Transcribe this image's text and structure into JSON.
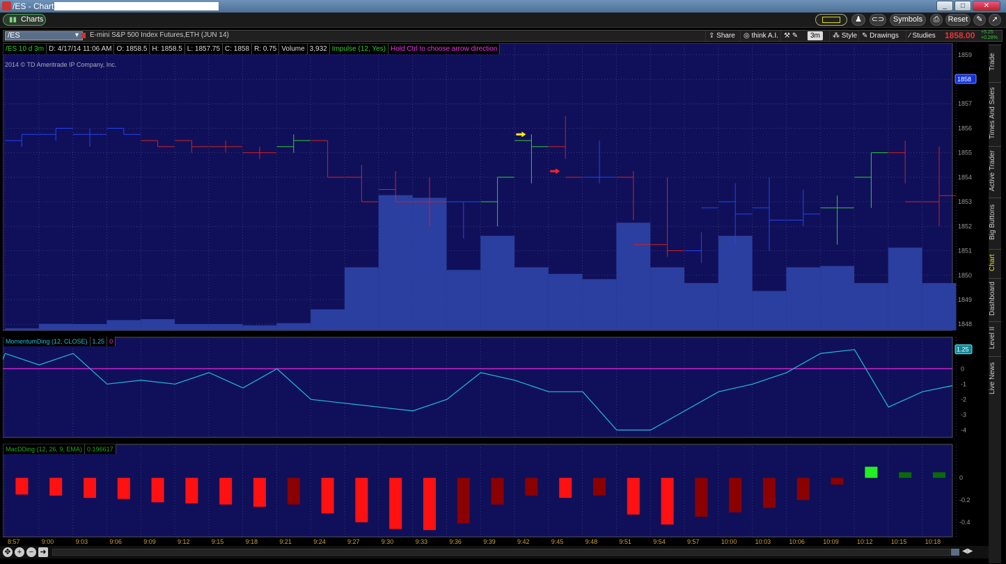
{
  "window": {
    "title": "/ES - Charts -"
  },
  "toolbar": {
    "charts_label": "Charts",
    "symbols_label": "Symbols",
    "reset_label": "Reset"
  },
  "chart_header": {
    "symbol": "/ES",
    "description": "E-mini S&P 500 Index Futures,ETH (JUN 14)",
    "buttons": {
      "share": "Share",
      "think_ai": "think A.I.",
      "timeframe": "3m",
      "style": "Style",
      "drawings": "Drawings",
      "studies": "Studies"
    },
    "last_price": "1858.00",
    "change": "+5.25",
    "change_pct": "+0.28%"
  },
  "infobar": {
    "period": "/ES 10 d 3m",
    "date": "D: 4/17/14 11:06 AM",
    "open": "O: 1858.5",
    "high": "H: 1858.5",
    "low": "L: 1857.75",
    "close": "C: 1858",
    "range": "R: 0.75",
    "volume_label": "Volume",
    "volume": "3,932",
    "impulse": "Impulse (12, Yes)",
    "hint": "Hold Ctrl to choose arrow direction"
  },
  "copyright": "2014 © TD Ameritrade IP Company, Inc.",
  "momentum": {
    "label": "MomentumDing (12, CLOSE)",
    "value": "1.25",
    "zero": "0"
  },
  "macd": {
    "label": "MacDDing (12, 26, 9, EMA)",
    "value": "0.196617"
  },
  "right_nav": [
    "Trade",
    "Times And Sales",
    "Active Trader",
    "Big Buttons",
    "Chart",
    "Dashboard",
    "Level II",
    "Live News"
  ],
  "colors": {
    "background": "#10105a",
    "up": "#33cc33",
    "down": "#d42020",
    "neutral": "#2244ee",
    "volume": "#2a3fa0",
    "momentum": "#22bbdd",
    "zeroline": "#cc22cc"
  },
  "chart_data": [
    {
      "type": "ohlc",
      "title": "/ES 10 d 3m",
      "x": [
        "8:57",
        "9:00",
        "9:03",
        "9:06",
        "9:09",
        "9:12",
        "9:15",
        "9:18",
        "9:21",
        "9:24",
        "9:27",
        "9:30",
        "9:33",
        "9:36",
        "9:39",
        "9:42",
        "9:45",
        "9:48",
        "9:51",
        "9:54",
        "9:57",
        "10:00",
        "10:03",
        "10:06",
        "10:09",
        "10:12",
        "10:15",
        "10:18"
      ],
      "open": [
        1855.5,
        1855.75,
        1855.75,
        1856.0,
        1855.5,
        1855.5,
        1855.25,
        1855.0,
        1855.25,
        1855.5,
        1854.0,
        1853.5,
        1853.0,
        1853.0,
        1853.0,
        1855.5,
        1855.25,
        1854.0,
        1854.0,
        1851.25,
        1851.0,
        1853.0,
        1852.75,
        1852.25,
        1852.75,
        1854.0,
        1855.0,
        1853.0
      ],
      "high": [
        1855.75,
        1856.0,
        1856.0,
        1856.0,
        1855.5,
        1855.5,
        1855.5,
        1855.25,
        1855.75,
        1855.5,
        1854.5,
        1854.25,
        1854.0,
        1853.0,
        1854.0,
        1855.75,
        1856.5,
        1855.5,
        1854.25,
        1854.0,
        1851.75,
        1853.75,
        1854.0,
        1853.5,
        1853.25,
        1855.0,
        1855.5,
        1855.25
      ],
      "high2": [
        1855.75,
        1856.0,
        1856.0,
        1856.0,
        1855.5,
        1855.5,
        1855.5,
        1855.25,
        1855.75,
        1855.5,
        1854.5,
        1854.25,
        1854.0,
        1853.0,
        1854.0,
        1855.75,
        1856.5,
        1855.25,
        1854.25,
        1854.0,
        1851.75,
        1853.75,
        1854.0,
        1853.5,
        1853.25,
        1855.0,
        1855.5,
        1855.25
      ],
      "low": [
        1855.25,
        1855.5,
        1855.25,
        1855.75,
        1855.25,
        1855.0,
        1855.0,
        1854.75,
        1855.0,
        1854.0,
        1853.0,
        1853.0,
        1852.0,
        1851.5,
        1852.0,
        1853.75,
        1854.75,
        1853.75,
        1852.25,
        1850.75,
        1850.5,
        1851.25,
        1851.0,
        1852.0,
        1851.25,
        1852.75,
        1853.75,
        1852.0
      ],
      "close": [
        1855.75,
        1856.0,
        1855.75,
        1855.75,
        1855.25,
        1855.25,
        1855.25,
        1855.0,
        1855.5,
        1854.0,
        1853.0,
        1853.0,
        1853.0,
        1853.0,
        1854.0,
        1855.25,
        1854.0,
        1854.0,
        1851.25,
        1851.0,
        1852.75,
        1852.5,
        1852.25,
        1852.5,
        1852.75,
        1855.0,
        1853.0,
        1853.25
      ],
      "bar_color": [
        "neutral",
        "neutral",
        "neutral",
        "neutral",
        "down",
        "down",
        "down",
        "down",
        "up",
        "down",
        "down",
        "down",
        "down",
        "neutral",
        "up",
        "up",
        "down",
        "neutral",
        "down",
        "down",
        "neutral",
        "neutral",
        "neutral",
        "neutral",
        "up",
        "up",
        "down",
        "down"
      ],
      "volume": [
        150,
        500,
        480,
        780,
        850,
        480,
        480,
        380,
        550,
        1600,
        4800,
        10300,
        10100,
        4600,
        7200,
        4800,
        4300,
        3900,
        8200,
        4800,
        3600,
        7200,
        3000,
        4800,
        4900,
        3600,
        6300,
        3600
      ],
      "ylim": [
        1847.75,
        1859.25
      ],
      "yticks": [
        1848,
        1849,
        1850,
        1851,
        1852,
        1853,
        1854,
        1855,
        1856,
        1857,
        1858,
        1859
      ],
      "price_label": "1858",
      "arrows": [
        {
          "x": "9:42",
          "y": 1855.75,
          "color": "yellow"
        },
        {
          "x": "9:45",
          "y": 1854.25,
          "color": "red"
        }
      ]
    },
    {
      "type": "line",
      "title": "MomentumDing (12, CLOSE)",
      "x": [
        "8:57",
        "9:00",
        "9:03",
        "9:06",
        "9:09",
        "9:12",
        "9:15",
        "9:18",
        "9:21",
        "9:24",
        "9:27",
        "9:30",
        "9:33",
        "9:36",
        "9:39",
        "9:42",
        "9:45",
        "9:48",
        "9:51",
        "9:54",
        "9:57",
        "10:00",
        "10:03",
        "10:06",
        "10:09",
        "10:12",
        "10:15",
        "10:18"
      ],
      "values": [
        1.0,
        0.25,
        1.0,
        -1.0,
        -0.75,
        -1.0,
        -0.25,
        -1.25,
        0.0,
        -2.0,
        -2.25,
        -2.5,
        -2.75,
        -2.0,
        -0.25,
        -0.75,
        -1.5,
        -1.5,
        -4.0,
        -4.0,
        -2.75,
        -1.5,
        -1.0,
        -0.25,
        1.0,
        1.25,
        -2.5,
        -1.5
      ],
      "ylim": [
        -4.3,
        1.6
      ],
      "yticks": [
        -4,
        -3,
        -2,
        -1,
        0
      ],
      "value_label": "1.25"
    },
    {
      "type": "bar",
      "title": "MacDDing (12, 26, 9, EMA)",
      "x": [
        "8:57",
        "9:00",
        "9:03",
        "9:06",
        "9:09",
        "9:12",
        "9:15",
        "9:18",
        "9:21",
        "9:24",
        "9:27",
        "9:30",
        "9:33",
        "9:36",
        "9:39",
        "9:42",
        "9:45",
        "9:48",
        "9:51",
        "9:54",
        "9:57",
        "10:00",
        "10:03",
        "10:06",
        "10:09",
        "10:12",
        "10:15",
        "10:18"
      ],
      "values": [
        -0.15,
        -0.16,
        -0.18,
        -0.19,
        -0.22,
        -0.23,
        -0.24,
        -0.26,
        -0.24,
        -0.32,
        -0.4,
        -0.46,
        -0.47,
        -0.41,
        -0.24,
        -0.16,
        -0.18,
        -0.16,
        -0.33,
        -0.42,
        -0.35,
        -0.31,
        -0.27,
        -0.2,
        -0.06,
        0.1,
        0.05,
        0.05
      ],
      "colors": [
        "down",
        "down",
        "down",
        "down",
        "down",
        "down",
        "down",
        "down",
        "darkdown",
        "down",
        "down",
        "down",
        "down",
        "darkdown",
        "darkdown",
        "darkdown",
        "down",
        "darkdown",
        "down",
        "down",
        "darkdown",
        "darkdown",
        "darkdown",
        "darkdown",
        "darkdown",
        "up",
        "darkup",
        "darkup"
      ],
      "ylim": [
        -0.5,
        0.22
      ],
      "yticks": [
        "0",
        "-0.2",
        "-0.4"
      ],
      "ytick_values": [
        0,
        -0.2,
        -0.4
      ]
    }
  ]
}
